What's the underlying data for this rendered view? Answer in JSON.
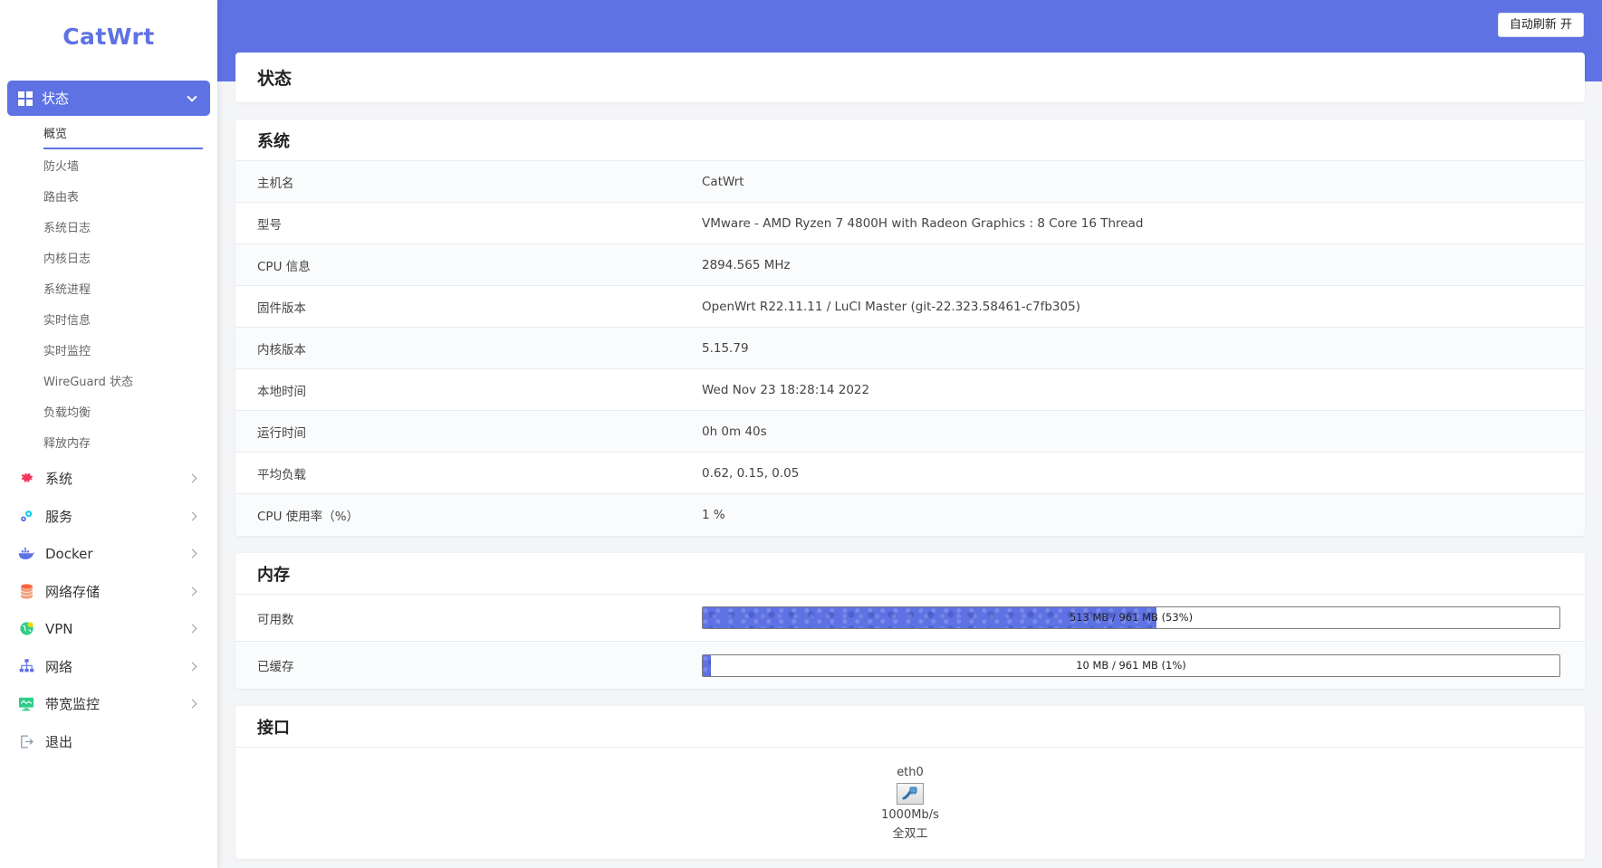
{
  "sidebar": {
    "logo": "CatWrt",
    "active_menu": "状态",
    "submenu": [
      "概览",
      "防火墙",
      "路由表",
      "系统日志",
      "内核日志",
      "系统进程",
      "实时信息",
      "实时监控",
      "WireGuard 状态",
      "负载均衡",
      "释放内存"
    ],
    "items": [
      {
        "label": "系统",
        "icon": "gear-icon",
        "color": "#f5365c"
      },
      {
        "label": "服务",
        "icon": "services-icon",
        "color": "#11cdef"
      },
      {
        "label": "Docker",
        "icon": "docker-icon",
        "color": "#5e72e4"
      },
      {
        "label": "网络存储",
        "icon": "storage-icon",
        "color": "#fb6340"
      },
      {
        "label": "VPN",
        "icon": "vpn-icon",
        "color": "#2dce89"
      },
      {
        "label": "网络",
        "icon": "network-icon",
        "color": "#5e72e4"
      },
      {
        "label": "带宽监控",
        "icon": "monitor-icon",
        "color": "#2dce89"
      },
      {
        "label": "退出",
        "icon": "logout-icon",
        "color": "#8898aa"
      }
    ]
  },
  "header": {
    "autorefresh_label": "自动刷新 开"
  },
  "page": {
    "title": "状态"
  },
  "system": {
    "title": "系统",
    "rows": [
      {
        "k": "主机名",
        "v": "CatWrt"
      },
      {
        "k": "型号",
        "v": "VMware - AMD Ryzen 7 4800H with Radeon Graphics : 8 Core 16 Thread"
      },
      {
        "k": "CPU 信息",
        "v": "2894.565 MHz"
      },
      {
        "k": "固件版本",
        "v": "OpenWrt R22.11.11 / LuCI Master (git-22.323.58461-c7fb305)"
      },
      {
        "k": "内核版本",
        "v": "5.15.79"
      },
      {
        "k": "本地时间",
        "v": "Wed Nov 23 18:28:14 2022"
      },
      {
        "k": "运行时间",
        "v": "0h 0m 40s"
      },
      {
        "k": "平均负载",
        "v": "0.62, 0.15, 0.05"
      },
      {
        "k": "CPU 使用率（%）",
        "v": "1 %"
      }
    ]
  },
  "memory": {
    "title": "内存",
    "rows": [
      {
        "k": "可用数",
        "label": "513 MB / 961 MB (53%)",
        "percent": 53
      },
      {
        "k": "已缓存",
        "label": "10 MB / 961 MB (1%)",
        "percent": 1
      }
    ]
  },
  "interfaces": {
    "title": "接口",
    "items": [
      {
        "name": "eth0",
        "speed": "1000Mb/s",
        "duplex": "全双工"
      }
    ]
  }
}
